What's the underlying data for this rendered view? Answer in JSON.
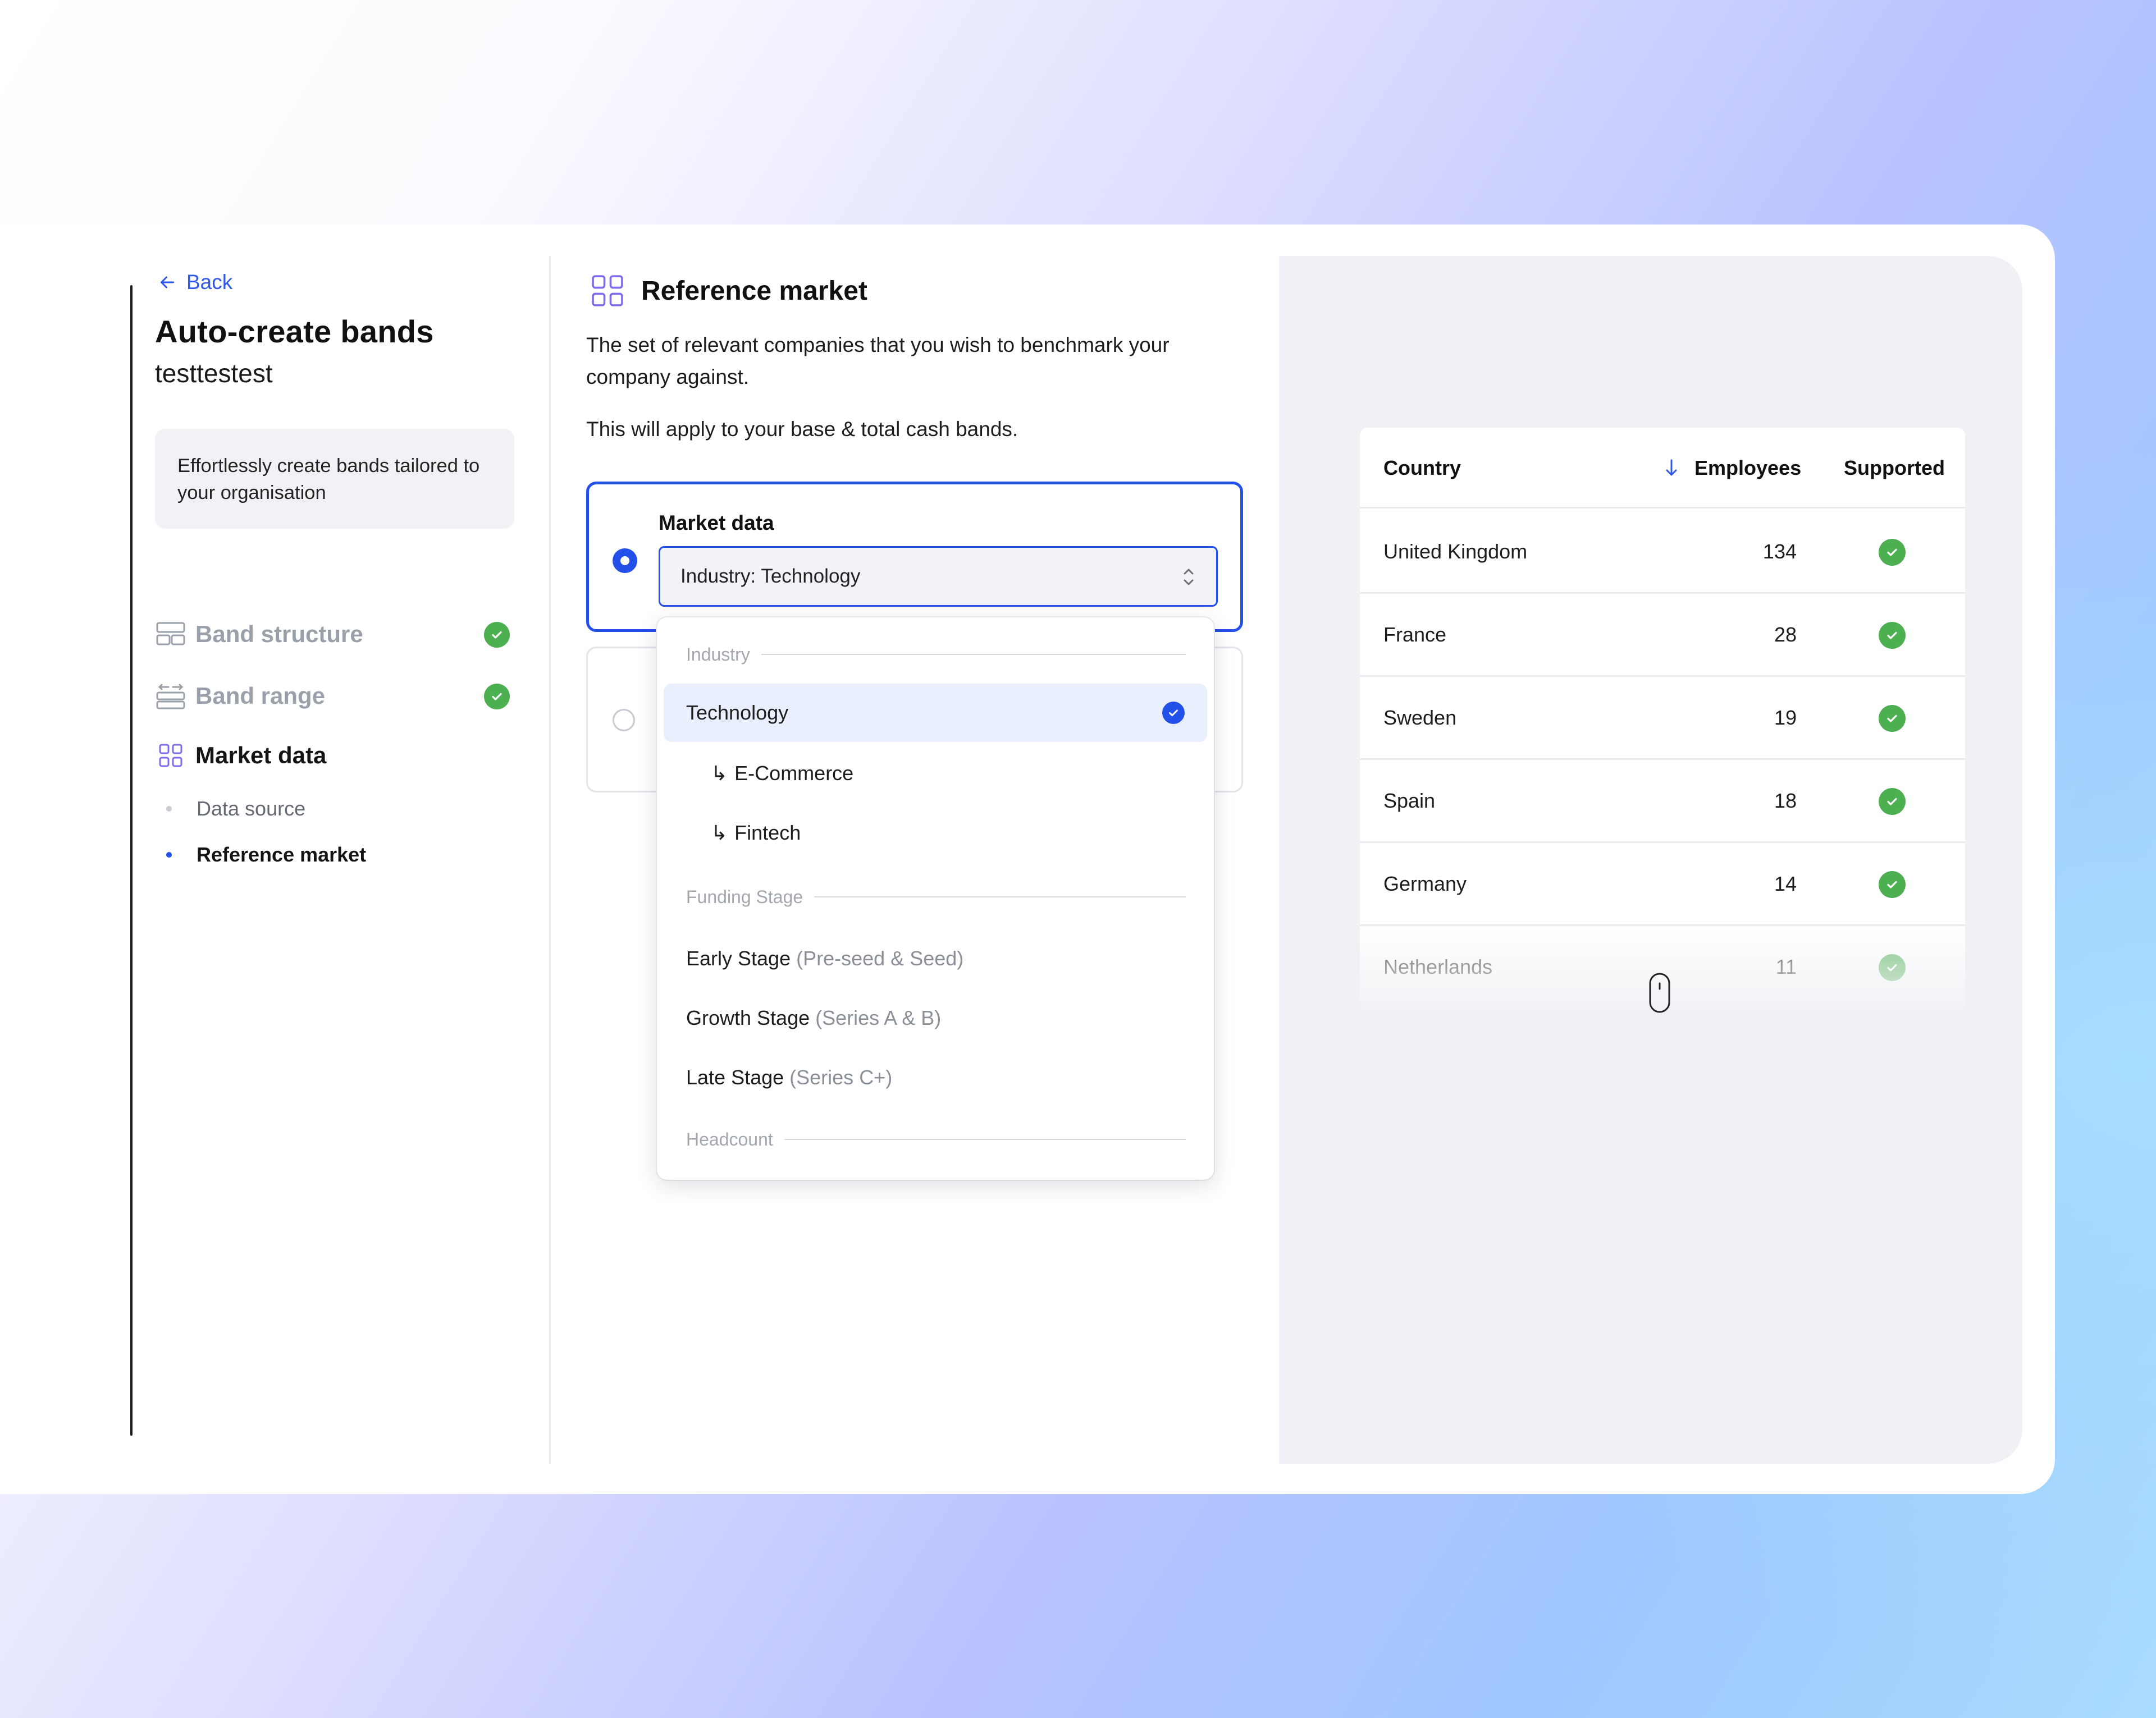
{
  "sidebar": {
    "back_label": "Back",
    "title": "Auto-create bands",
    "subtitle": "testtestest",
    "info": "Effortlessly create bands tailored to your organisation",
    "steps": [
      {
        "label": "Band structure",
        "icon": "band-structure-icon",
        "status": "complete"
      },
      {
        "label": "Band range",
        "icon": "band-range-icon",
        "status": "complete"
      },
      {
        "label": "Market data",
        "icon": "grid-icon",
        "status": "active"
      }
    ],
    "sub_steps": [
      {
        "label": "Data source",
        "status": "inactive"
      },
      {
        "label": "Reference market",
        "status": "active"
      }
    ]
  },
  "main": {
    "icon": "grid-icon",
    "title": "Reference market",
    "description": "The set of relevant companies that you wish to benchmark your company against.",
    "note": "This will apply to your base & total cash bands.",
    "option_label": "Market data",
    "select_value": "Industry: Technology"
  },
  "dropdown": {
    "groups": [
      "Industry",
      "Funding Stage",
      "Headcount"
    ],
    "options": [
      {
        "label": "Technology",
        "selected": true
      },
      {
        "label": "E-Commerce",
        "prefix": "↳"
      },
      {
        "label": "Fintech",
        "prefix": "↳"
      },
      {
        "label": "Early Stage",
        "detail": "(Pre-seed & Seed)"
      },
      {
        "label": "Growth Stage",
        "detail": "(Series A & B)"
      },
      {
        "label": "Late Stage",
        "detail": "(Series C+)"
      }
    ]
  },
  "table": {
    "headers": [
      "Country",
      "Employees",
      "Supported"
    ],
    "sort_icon": "arrow-down-icon",
    "rows": [
      {
        "country": "United Kingdom",
        "employees": "134"
      },
      {
        "country": "France",
        "employees": "28"
      },
      {
        "country": "Sweden",
        "employees": "19"
      },
      {
        "country": "Spain",
        "employees": "18"
      },
      {
        "country": "Germany",
        "employees": "14"
      },
      {
        "country": "Netherlands",
        "employees": "11"
      }
    ]
  },
  "colors": {
    "accent": "#2450ea",
    "success": "#4cb050",
    "muted": "#9aa0a9",
    "panel": "#f0f1f5"
  }
}
